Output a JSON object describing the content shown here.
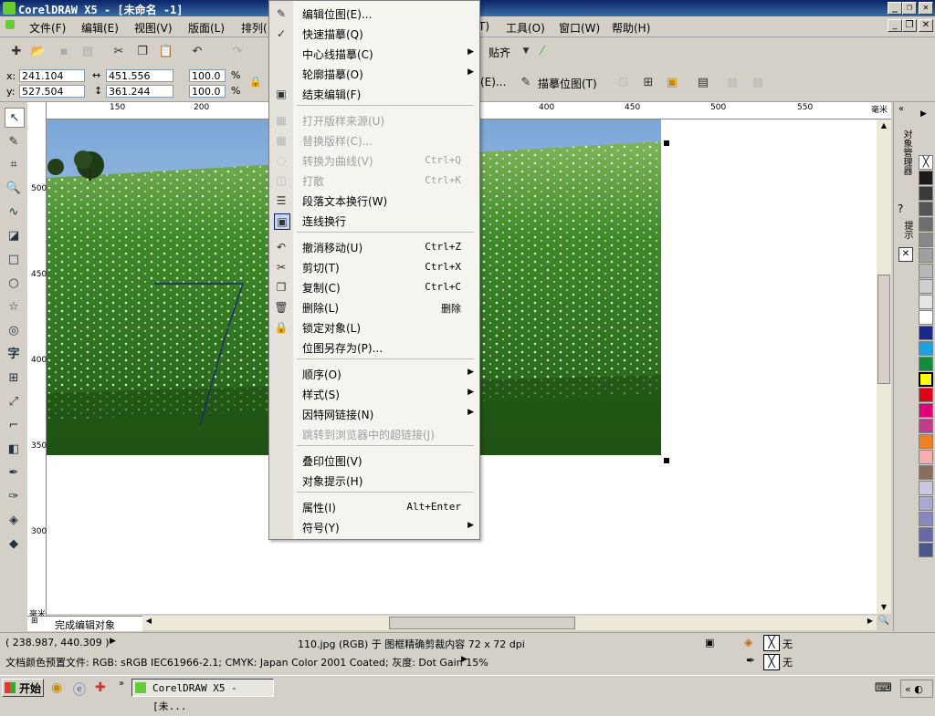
{
  "window": {
    "title": "CorelDRAW X5 - [未命名 -1]"
  },
  "menubar": [
    "文件(F)",
    "编辑(E)",
    "视图(V)",
    "版面(L)",
    "排列(",
    "T)",
    "工具(O)",
    "窗口(W)",
    "帮助(H)"
  ],
  "toolbar": {
    "snap_label": "贴齐"
  },
  "propbar": {
    "x_label": "x:",
    "x_value": "241.104 mm",
    "y_label": "y:",
    "y_value": "527.504 mm",
    "w_value": "451.556 mm",
    "h_value": "361.244 mm",
    "scale_x": "100.0",
    "scale_y": "100.0",
    "pct": "%",
    "trace_partial": "(E)...",
    "trace_bitmap": "描摹位图(T)"
  },
  "hruler_ticks": [
    "150",
    "200",
    "400",
    "450",
    "500",
    "550",
    "毫米"
  ],
  "vruler_ticks": [
    "500",
    "450",
    "400",
    "350",
    "300",
    "毫米"
  ],
  "context_menu": {
    "items": [
      {
        "label": "编辑位图(E)...",
        "shortcut": "",
        "arrow": false,
        "disabled": false,
        "icon": "edit-bitmap-icon",
        "glyph": "✎"
      },
      {
        "label": "快速描摹(Q)",
        "shortcut": "",
        "arrow": false,
        "disabled": false,
        "icon": "quick-trace-icon",
        "glyph": "✓"
      },
      {
        "label": "中心线描摹(C)",
        "shortcut": "",
        "arrow": true,
        "disabled": false,
        "icon": "",
        "glyph": ""
      },
      {
        "label": "轮廓描摹(O)",
        "shortcut": "",
        "arrow": true,
        "disabled": false,
        "icon": "",
        "glyph": ""
      },
      {
        "label": "结束编辑(F)",
        "shortcut": "",
        "arrow": false,
        "disabled": false,
        "icon": "finish-edit-icon",
        "glyph": "▣"
      },
      {
        "label": "打开版样来源(U)",
        "shortcut": "",
        "arrow": false,
        "disabled": true,
        "icon": "open-source-icon",
        "glyph": "▦"
      },
      {
        "label": "替换版样(C)...",
        "shortcut": "",
        "arrow": false,
        "disabled": true,
        "icon": "replace-icon",
        "glyph": "▦"
      },
      {
        "label": "转换为曲线(V)",
        "shortcut": "Ctrl+Q",
        "arrow": false,
        "disabled": true,
        "icon": "convert-curves-icon",
        "glyph": "◌"
      },
      {
        "label": "打散",
        "shortcut": "Ctrl+K",
        "arrow": false,
        "disabled": true,
        "icon": "break-apart-icon",
        "glyph": "◫"
      },
      {
        "label": "段落文本换行(W)",
        "shortcut": "",
        "arrow": false,
        "disabled": false,
        "icon": "text-wrap-icon",
        "glyph": "☰"
      },
      {
        "label": "连线换行",
        "shortcut": "",
        "arrow": false,
        "disabled": false,
        "icon": "line-wrap-icon",
        "glyph": "▣"
      },
      {
        "label": "撤消移动(U)",
        "shortcut": "Ctrl+Z",
        "arrow": false,
        "disabled": false,
        "icon": "undo-icon",
        "glyph": "↶"
      },
      {
        "label": "剪切(T)",
        "shortcut": "Ctrl+X",
        "arrow": false,
        "disabled": false,
        "icon": "scissors-icon",
        "glyph": "✂"
      },
      {
        "label": "复制(C)",
        "shortcut": "Ctrl+C",
        "arrow": false,
        "disabled": false,
        "icon": "copy-icon",
        "glyph": "❐"
      },
      {
        "label": "删除(L)",
        "shortcut": "删除",
        "arrow": false,
        "disabled": false,
        "icon": "trash-icon",
        "glyph": "🗑"
      },
      {
        "label": "锁定对象(L)",
        "shortcut": "",
        "arrow": false,
        "disabled": false,
        "icon": "lock-icon",
        "glyph": "🔒"
      },
      {
        "label": "位图另存为(P)...",
        "shortcut": "",
        "arrow": false,
        "disabled": false,
        "icon": "",
        "glyph": ""
      },
      {
        "label": "顺序(O)",
        "shortcut": "",
        "arrow": true,
        "disabled": false,
        "icon": "",
        "glyph": ""
      },
      {
        "label": "样式(S)",
        "shortcut": "",
        "arrow": true,
        "disabled": false,
        "icon": "",
        "glyph": ""
      },
      {
        "label": "因特网链接(N)",
        "shortcut": "",
        "arrow": true,
        "disabled": false,
        "icon": "",
        "glyph": ""
      },
      {
        "label": "跳转到浏览器中的超链接(J)",
        "shortcut": "",
        "arrow": false,
        "disabled": true,
        "icon": "",
        "glyph": ""
      },
      {
        "label": "叠印位图(V)",
        "shortcut": "",
        "arrow": false,
        "disabled": false,
        "icon": "",
        "glyph": ""
      },
      {
        "label": "对象提示(H)",
        "shortcut": "",
        "arrow": false,
        "disabled": false,
        "icon": "",
        "glyph": ""
      },
      {
        "label": "属性(I)",
        "shortcut": "Alt+Enter",
        "arrow": false,
        "disabled": false,
        "icon": "",
        "glyph": ""
      },
      {
        "label": "符号(Y)",
        "shortcut": "",
        "arrow": true,
        "disabled": false,
        "icon": "",
        "glyph": ""
      }
    ]
  },
  "page_tab": "完成编辑对象",
  "docker": {
    "object_manager": "对象管理器",
    "hints": "提示"
  },
  "palette": [
    "#ffffff",
    "#1f1a17",
    "#3a3a3a",
    "#555555",
    "#6e6e6e",
    "#888888",
    "#a0a0a0",
    "#b8b8b8",
    "#cfcfcf",
    "#e6e6e6",
    "#ffffff",
    "#1b2a8a",
    "#1da1e0",
    "#0f8c3c",
    "#ffff00",
    "#e1001a",
    "#e2007a",
    "#c03c8c",
    "#f08020",
    "#f4b0b0",
    "#8a6e5c",
    "#c8c8e0",
    "#a8a8d0",
    "#8888c0",
    "#6868a8",
    "#485888"
  ],
  "status": {
    "coords": "( 238.987, 440.309 )",
    "info": "110.jpg (RGB) 于 图框精确剪裁内容 72 x 72 dpi",
    "fill_none": "无",
    "outline_none": "无",
    "profile": "文档颜色预置文件: RGB: sRGB IEC61966-2.1; CMYK: Japan Color 2001 Coated; 灰度: Dot Gain 15%"
  },
  "taskbar": {
    "start": "开始",
    "task": "CorelDRAW X5 - [未..."
  }
}
